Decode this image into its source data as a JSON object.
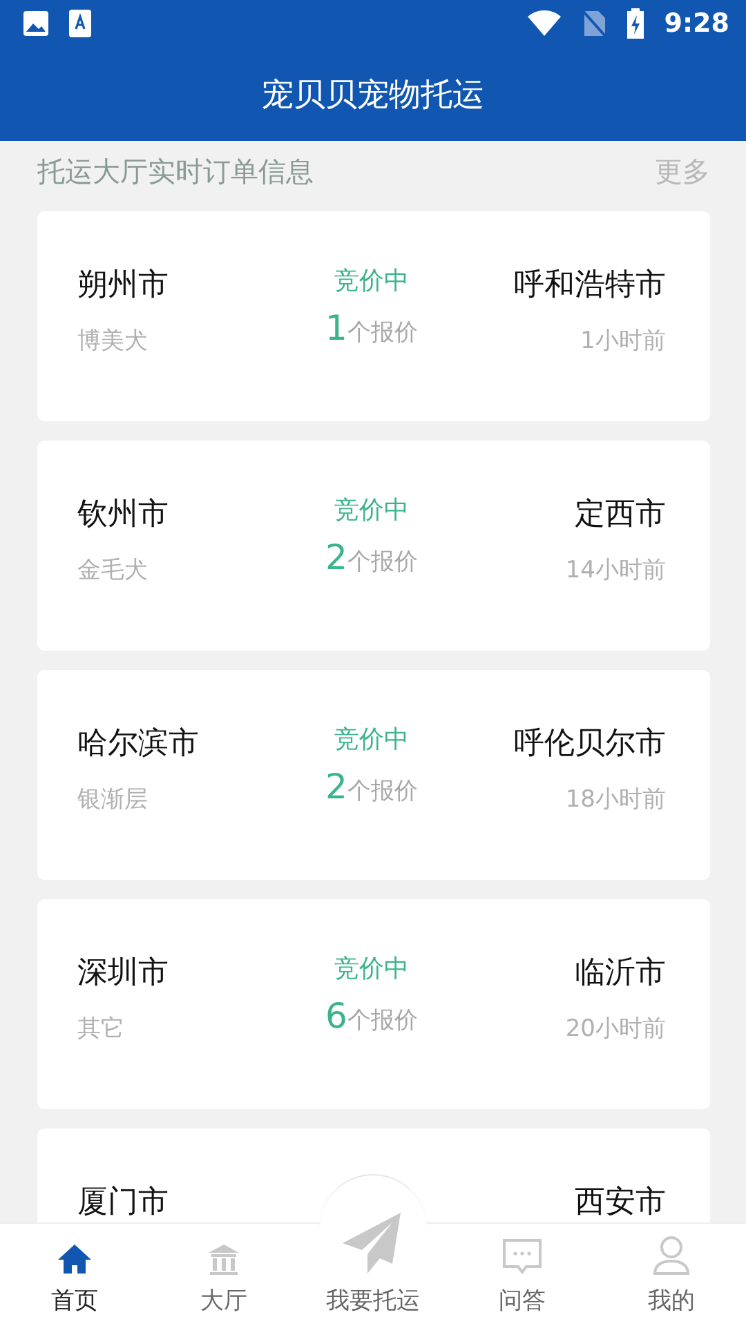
{
  "status_bar": {
    "time": "9:28"
  },
  "app_bar": {
    "title": "宠贝贝宠物托运"
  },
  "section": {
    "title": "托运大厅实时订单信息",
    "more": "更多"
  },
  "orders": [
    {
      "origin": "朔州市",
      "breed": "博美犬",
      "status": "竞价中",
      "count": "1",
      "count_label": "个报价",
      "destination": "呼和浩特市",
      "time": "1小时前"
    },
    {
      "origin": "钦州市",
      "breed": "金毛犬",
      "status": "竞价中",
      "count": "2",
      "count_label": "个报价",
      "destination": "定西市",
      "time": "14小时前"
    },
    {
      "origin": "哈尔滨市",
      "breed": "银渐层",
      "status": "竞价中",
      "count": "2",
      "count_label": "个报价",
      "destination": "呼伦贝尔市",
      "time": "18小时前"
    },
    {
      "origin": "深圳市",
      "breed": "其它",
      "status": "竞价中",
      "count": "6",
      "count_label": "个报价",
      "destination": "临沂市",
      "time": "20小时前"
    },
    {
      "origin": "厦门市",
      "destination": "西安市"
    }
  ],
  "tabs": [
    {
      "label": "首页",
      "kind": "home",
      "selected": true
    },
    {
      "label": "大厅",
      "kind": "hall",
      "selected": false
    },
    {
      "label": "我要托运",
      "kind": "send",
      "selected": false
    },
    {
      "label": "问答",
      "kind": "chat",
      "selected": false
    },
    {
      "label": "我的",
      "kind": "user",
      "selected": false
    }
  ]
}
